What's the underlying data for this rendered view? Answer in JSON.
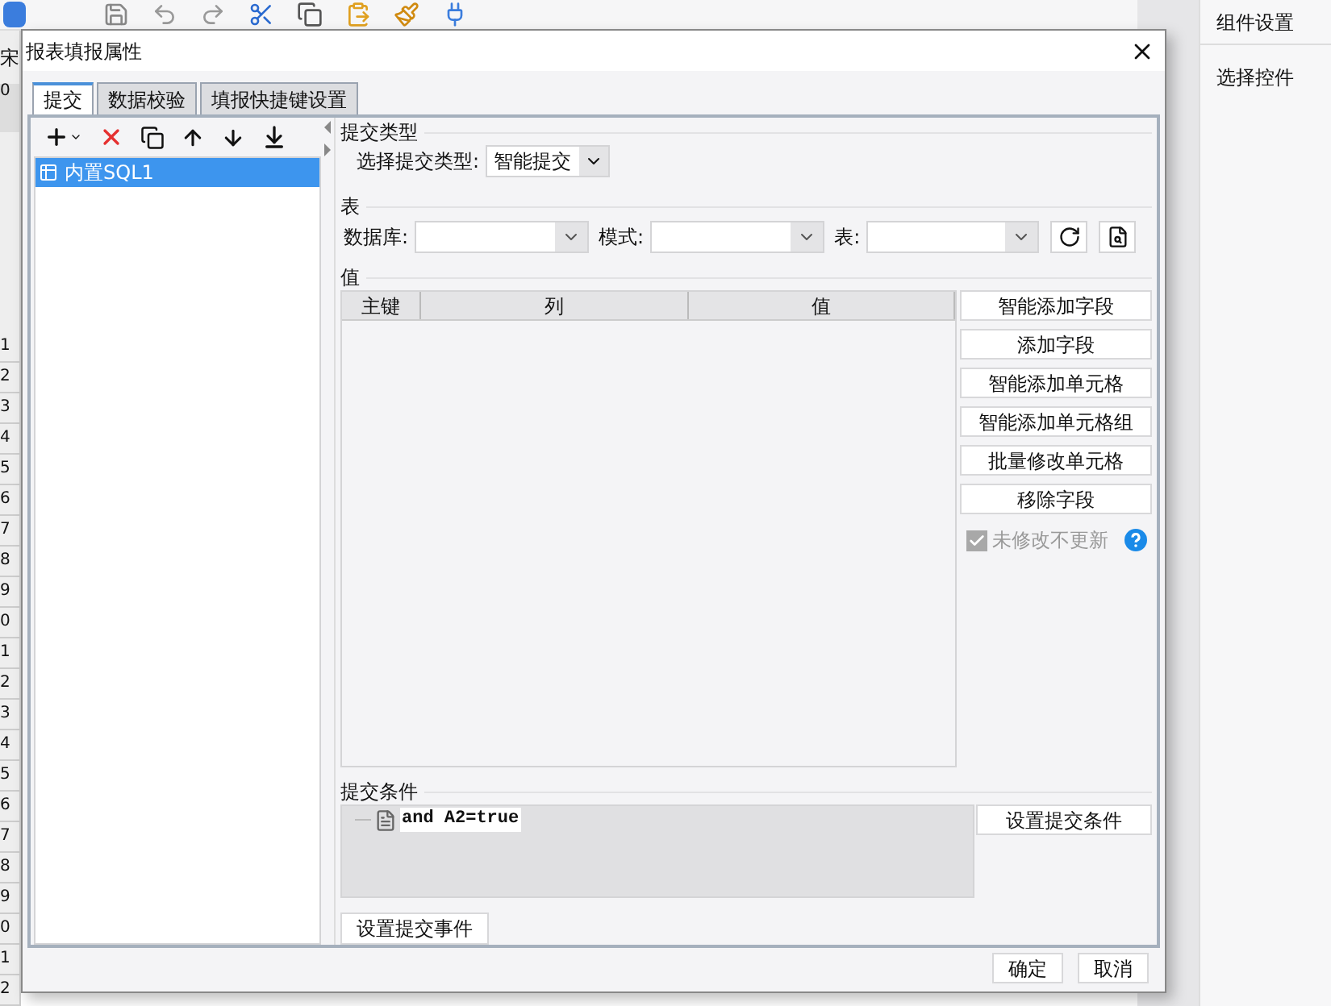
{
  "app": {
    "font_box": "宋",
    "ruler_mark": "0",
    "row_numbers": [
      "1",
      "2",
      "3",
      "4",
      "5",
      "6",
      "7",
      "8",
      "9",
      "0",
      "1",
      "2",
      "3",
      "4",
      "5",
      "6",
      "7",
      "8",
      "9",
      "0",
      "1",
      "2"
    ],
    "side_panel": {
      "title": "组件设置",
      "label": "选择控件"
    }
  },
  "dialog": {
    "title": "报表填报属性",
    "tabs": [
      {
        "label": "提交",
        "selected": true
      },
      {
        "label": "数据校验",
        "selected": false
      },
      {
        "label": "填报快捷键设置",
        "selected": false
      }
    ],
    "submit_list": [
      {
        "label": "内置SQL1",
        "selected": true
      }
    ],
    "submit_type": {
      "legend": "提交类型",
      "label": "选择提交类型:",
      "value": "智能提交"
    },
    "table_section": {
      "legend": "表",
      "fields": [
        {
          "label": "数据库:"
        },
        {
          "label": "模式:"
        },
        {
          "label": "表:"
        }
      ]
    },
    "values": {
      "legend": "值",
      "columns": [
        "主键",
        "列",
        "值"
      ],
      "buttons": [
        "智能添加字段",
        "添加字段",
        "智能添加单元格",
        "智能添加单元格组",
        "批量修改单元格",
        "移除字段"
      ],
      "checkbox": {
        "label": "未修改不更新",
        "checked": true,
        "disabled": true
      }
    },
    "condition": {
      "legend": "提交条件",
      "items": [
        "and A2=true"
      ],
      "button": "设置提交条件"
    },
    "event_button": "设置提交事件",
    "footer_buttons": [
      "确定",
      "取消"
    ]
  }
}
